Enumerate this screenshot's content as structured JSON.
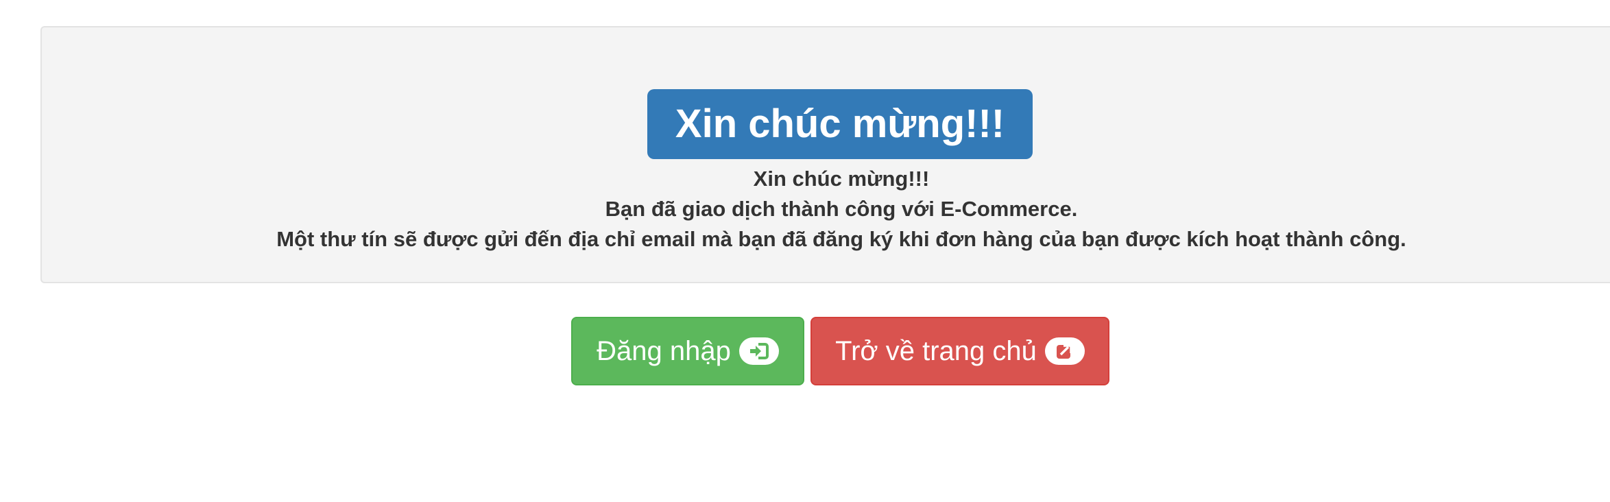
{
  "jumbotron": {
    "heading": "Xin chúc mừng!!!",
    "lines": [
      "Xin chúc mừng!!!",
      "Bạn đã giao dịch thành công với E-Commerce.",
      "Một thư tín sẽ được gửi đến địa chỉ email mà bạn đã đăng ký khi đơn hàng của bạn được kích hoạt thành công."
    ]
  },
  "actions": {
    "login_label": "Đăng nhập",
    "login_icon": "sign-in-icon",
    "home_label": "Trở về trang chủ",
    "home_icon": "external-link-icon"
  },
  "colors": {
    "primary": "#337ab7",
    "success": "#5cb85c",
    "danger": "#d9534f",
    "jumbotron_bg": "#f4f4f4",
    "text": "#333333"
  }
}
